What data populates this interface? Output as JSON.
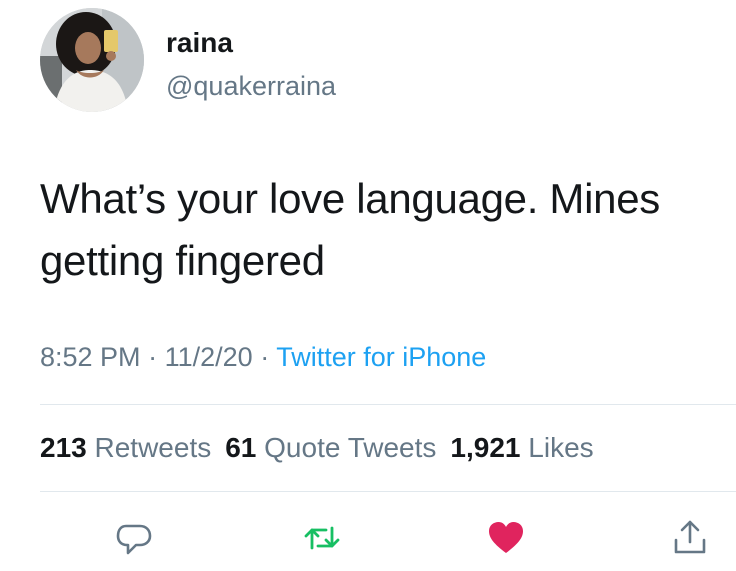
{
  "user": {
    "display_name": "raina",
    "handle": "@quakerraina"
  },
  "tweet": {
    "text": "What’s your love language. Mines getting fingered",
    "time": "8:52 PM",
    "date": "11/2/20",
    "separator": "·",
    "source": "Twitter for iPhone"
  },
  "stats": {
    "retweets_count": "213",
    "retweets_label": "Retweets",
    "quotes_count": "61",
    "quotes_label": "Quote Tweets",
    "likes_count": "1,921",
    "likes_label": "Likes"
  },
  "actions": {
    "reply_icon": "reply-icon",
    "retweet_icon": "retweet-icon",
    "like_icon": "heart-icon",
    "share_icon": "share-icon"
  },
  "colors": {
    "secondary_text": "#657786",
    "link_blue": "#1da1f2",
    "retweet_green": "#17bf63",
    "like_red": "#e0245e"
  }
}
